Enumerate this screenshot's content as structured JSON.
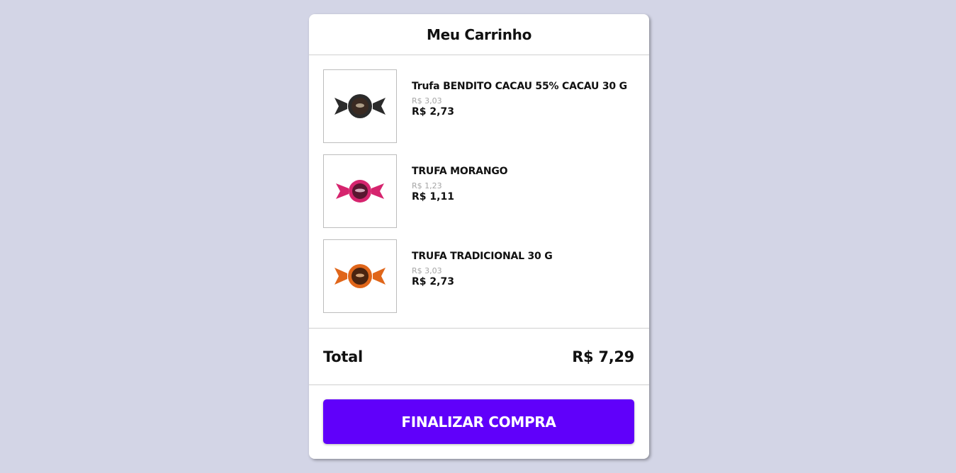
{
  "cart": {
    "title": "Meu Carrinho",
    "items": [
      {
        "name": "Trufa BENDITO CACAU 55% CACAU 30 G",
        "old_price": "R$ 3,03",
        "price": "R$ 2,73",
        "wrapper_color": "#2b2b2b",
        "body_color": "#3a2a22"
      },
      {
        "name": "TRUFA MORANGO",
        "old_price": "R$ 1,23",
        "price": "R$ 1,11",
        "wrapper_color": "#d6246e",
        "body_color": "#5a1630"
      },
      {
        "name": "TRUFA TRADICIONAL 30 G",
        "old_price": "R$ 3,03",
        "price": "R$ 2,73",
        "wrapper_color": "#e0661a",
        "body_color": "#4a2410"
      }
    ],
    "total_label": "Total",
    "total_value": "R$ 7,29",
    "checkout_label": "FINALIZAR COMPRA"
  },
  "colors": {
    "background": "#d3d5e6",
    "accent": "#6000fa"
  }
}
